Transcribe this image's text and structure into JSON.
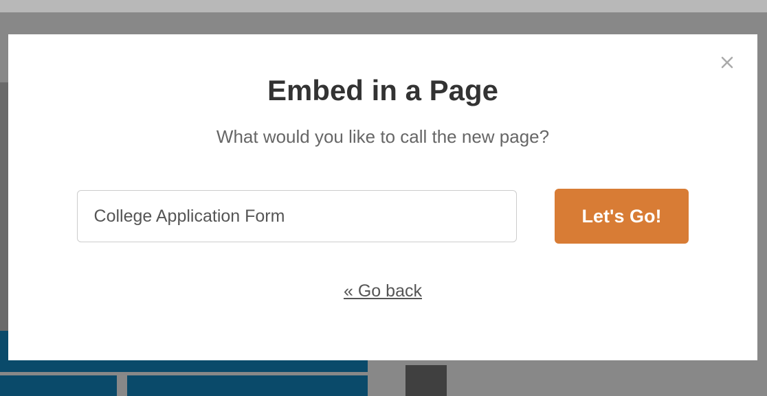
{
  "modal": {
    "title": "Embed in a Page",
    "subtitle": "What would you like to call the new page?",
    "page_name_value": "College Application Form",
    "lets_go_label": "Let's Go!",
    "go_back_label": "« Go back"
  }
}
